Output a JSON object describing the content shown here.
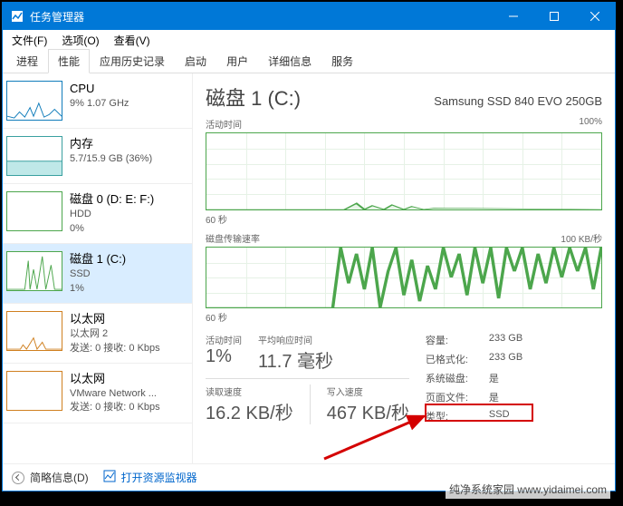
{
  "window": {
    "title": "任务管理器"
  },
  "menu": {
    "file": "文件(F)",
    "options": "选项(O)",
    "view": "查看(V)"
  },
  "tabs": {
    "items": [
      "进程",
      "性能",
      "应用历史记录",
      "启动",
      "用户",
      "详细信息",
      "服务"
    ],
    "active_index": 1
  },
  "sidebar": {
    "items": [
      {
        "name": "CPU",
        "line1": "9% 1.07 GHz"
      },
      {
        "name": "内存",
        "line1": "5.7/15.9 GB (36%)"
      },
      {
        "name": "磁盘 0 (D: E: F:)",
        "line1": "HDD",
        "line2": "0%"
      },
      {
        "name": "磁盘 1 (C:)",
        "line1": "SSD",
        "line2": "1%"
      },
      {
        "name": "以太网",
        "line1": "以太网 2",
        "line2": "发送: 0 接收: 0 Kbps"
      },
      {
        "name": "以太网",
        "line1": "VMware Network ...",
        "line2": "发送: 0 接收: 0 Kbps"
      }
    ]
  },
  "main": {
    "title": "磁盘 1 (C:)",
    "model": "Samsung SSD 840 EVO 250GB",
    "chart1": {
      "label": "活动时间",
      "max": "100%",
      "xaxis": "60 秒"
    },
    "chart2": {
      "label": "磁盘传输速率",
      "max": "100 KB/秒",
      "xaxis": "60 秒"
    },
    "stats": {
      "active": {
        "label": "活动时间",
        "value": "1%"
      },
      "resp": {
        "label": "平均响应时间",
        "value": "11.7 毫秒"
      },
      "read": {
        "label": "读取速度",
        "value": "16.2 KB/秒"
      },
      "write": {
        "label": "写入速度",
        "value": "467 KB/秒"
      }
    },
    "kv": {
      "capacity_l": "容量:",
      "capacity_v": "233 GB",
      "formatted_l": "已格式化:",
      "formatted_v": "233 GB",
      "sysdisk_l": "系统磁盘:",
      "sysdisk_v": "是",
      "pagefile_l": "页面文件:",
      "pagefile_v": "是",
      "type_l": "类型:",
      "type_v": "SSD"
    }
  },
  "footer": {
    "less": "简略信息(D)",
    "resmon": "打开资源监视器"
  },
  "watermark": "纯净系统家园 www.yidaimei.com",
  "chart_data": [
    {
      "type": "area",
      "title": "活动时间",
      "ylabel": "%",
      "ylim": [
        0,
        100
      ],
      "xlabel": "秒",
      "xrange": [
        60,
        0
      ],
      "values": [
        0,
        0,
        0,
        0,
        0,
        0,
        0,
        0,
        0,
        0,
        0,
        0,
        0,
        0,
        0,
        0,
        0,
        0,
        0,
        0,
        0,
        0,
        2,
        8,
        3,
        0,
        4,
        2,
        0,
        1,
        6,
        2,
        0,
        0,
        3,
        1,
        0,
        2,
        0,
        1,
        0,
        0,
        2,
        0,
        0,
        0,
        1,
        0,
        0,
        0,
        0,
        0,
        0,
        0,
        0,
        0,
        0,
        0,
        0,
        0
      ]
    },
    {
      "type": "area",
      "title": "磁盘传输速率",
      "ylabel": "KB/秒",
      "ylim": [
        0,
        100
      ],
      "xlabel": "秒",
      "xrange": [
        60,
        0
      ],
      "values": [
        0,
        0,
        0,
        0,
        0,
        0,
        0,
        0,
        0,
        0,
        0,
        0,
        0,
        0,
        0,
        0,
        0,
        0,
        0,
        0,
        100,
        40,
        90,
        30,
        100,
        0,
        60,
        100,
        20,
        80,
        10,
        70,
        30,
        100,
        50,
        90,
        20,
        100,
        40,
        80,
        15,
        100,
        60,
        100,
        30,
        90,
        10,
        100,
        50,
        20,
        100,
        40,
        100,
        60,
        100,
        30,
        80,
        100,
        50,
        100
      ]
    }
  ]
}
